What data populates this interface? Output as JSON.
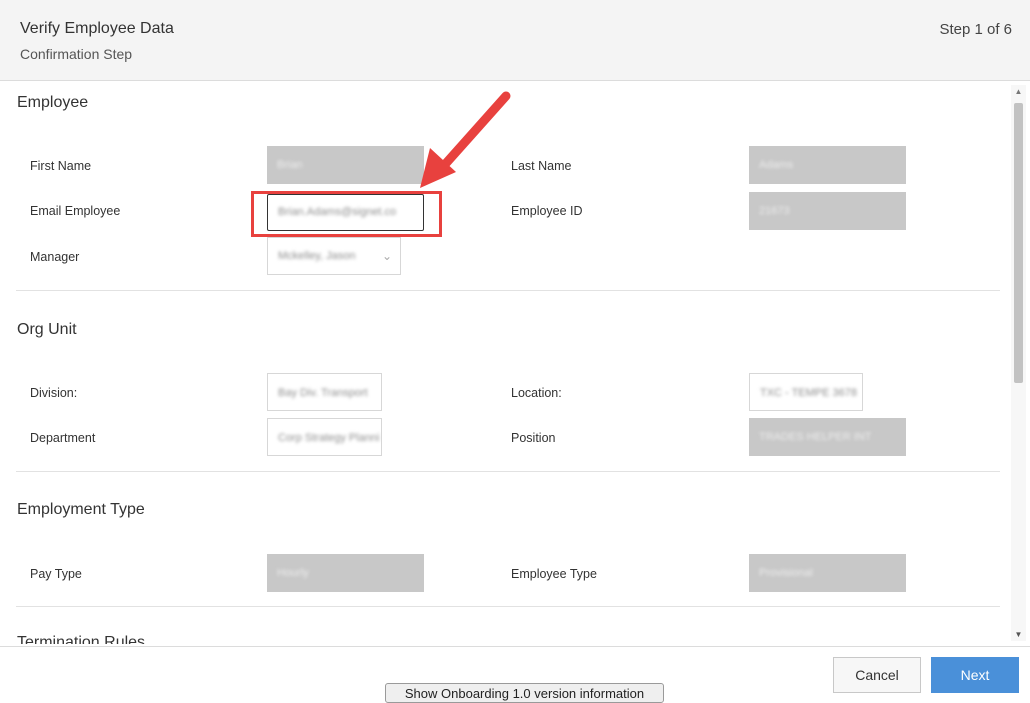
{
  "header": {
    "title": "Verify Employee Data",
    "subtitle": "Confirmation Step",
    "step": "Step 1 of 6"
  },
  "employee": {
    "section_title": "Employee",
    "first_name_label": "First Name",
    "first_name_value": "Brian",
    "last_name_label": "Last Name",
    "last_name_value": "Adams",
    "email_label": "Email Employee",
    "email_value": "Brian.Adams@signet.co",
    "employee_id_label": "Employee ID",
    "employee_id_value": "21673",
    "manager_label": "Manager",
    "manager_value": "Mckelley, Jason"
  },
  "org_unit": {
    "section_title": "Org Unit",
    "division_label": "Division:",
    "division_value": "Bay Div. Transport",
    "location_label": "Location:",
    "location_value": "TXC - TEMPE 3678",
    "department_label": "Department",
    "department_value": "Corp Strategy Planni",
    "position_label": "Position",
    "position_value": "TRADES HELPER INT"
  },
  "employment_type": {
    "section_title": "Employment Type",
    "pay_type_label": "Pay Type",
    "pay_type_value": "Hourly",
    "employee_type_label": "Employee Type",
    "employee_type_value": "Provisional"
  },
  "next_section_partial": "Termination Rules",
  "footer": {
    "cancel_label": "Cancel",
    "next_label": "Next",
    "info_label": "Show Onboarding 1.0 version information"
  },
  "colors": {
    "annotation": "#e8413e",
    "primary_button": "#4a90d9",
    "readonly_field": "#c8c8c8"
  }
}
